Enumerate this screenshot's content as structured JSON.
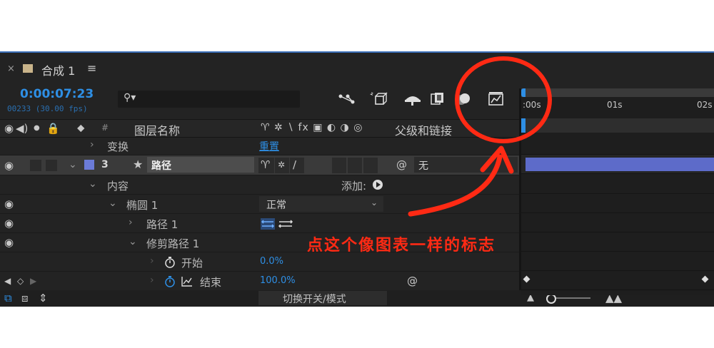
{
  "comp_tab": {
    "close": "×",
    "title": "合成 1",
    "menu": "≡"
  },
  "time": {
    "current": "0:00:07:23",
    "frames": "00233 (30.00 fps)"
  },
  "search": {
    "icon": "search-icon",
    "placeholder": ""
  },
  "ruler": {
    "ticks": [
      ":00s",
      "01s",
      "02s"
    ]
  },
  "header": {
    "hash": "#",
    "layer_name": "图层名称",
    "switch_icons": "♈ ✲ ∖ fx ▣ ◐ ◑ ◎",
    "parent": "父级和链接"
  },
  "rows": {
    "transform": {
      "label": "变换",
      "value": "重置"
    },
    "layer": {
      "number": "3",
      "name": "路径",
      "parent_value": "无"
    },
    "contents": {
      "label": "内容",
      "add_label": "添加:"
    },
    "ellipse": {
      "label": "椭圆 1",
      "mode": "正常"
    },
    "path": {
      "label": "路径 1"
    },
    "trim": {
      "label": "修剪路径 1"
    },
    "start": {
      "label": "开始",
      "value": "0.0%"
    },
    "end": {
      "label": "结束",
      "value": "100.0%"
    }
  },
  "footer": {
    "toggle_label": "切换开关/模式"
  },
  "annotation": {
    "text": "点这个像图表一样的标志"
  },
  "colors": {
    "accent": "#2e8fe5",
    "layer_label": "#6b7bd8",
    "timeline_bar": "#5d6bc9",
    "annotation": "#ff2a14"
  }
}
